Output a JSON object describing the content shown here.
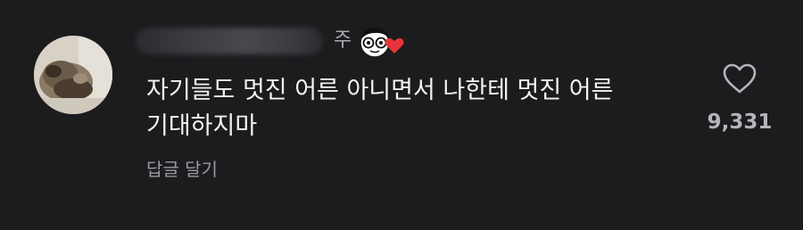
{
  "comment": {
    "username_suffix": "주",
    "text": "자기들도 멋진 어른 아니면서 나한테 멋진 어른 기대하지마",
    "reply_label": "답글 달기",
    "like_count": "9,331",
    "liked": false
  },
  "icons": {
    "badge": "smiling-face-with-heart-badge-icon",
    "like": "heart-outline-icon"
  },
  "colors": {
    "background": "#1c1c1e",
    "text_primary": "#f2f2f2",
    "text_secondary": "#9a9aa0",
    "heart_badge": "#e8343c"
  }
}
